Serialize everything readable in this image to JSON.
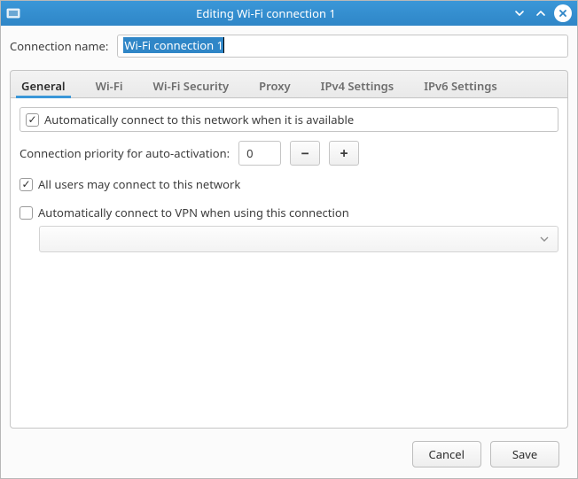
{
  "window": {
    "title": "Editing Wi-Fi connection 1"
  },
  "conn_name": {
    "label": "Connection name:",
    "value": "Wi-Fi connection 1"
  },
  "tabs": [
    {
      "label": "General",
      "active": true
    },
    {
      "label": "Wi-Fi",
      "active": false
    },
    {
      "label": "Wi-Fi Security",
      "active": false
    },
    {
      "label": "Proxy",
      "active": false
    },
    {
      "label": "IPv4 Settings",
      "active": false
    },
    {
      "label": "IPv6 Settings",
      "active": false
    }
  ],
  "general": {
    "auto_connect_label": "Automatically connect to this network when it is available",
    "auto_connect_checked": true,
    "priority_label": "Connection priority for auto-activation:",
    "priority_value": "0",
    "all_users_label": "All users may connect to this network",
    "all_users_checked": true,
    "auto_vpn_label": "Automatically connect to VPN when using this connection",
    "auto_vpn_checked": false,
    "vpn_selected": ""
  },
  "footer": {
    "cancel": "Cancel",
    "save": "Save"
  }
}
